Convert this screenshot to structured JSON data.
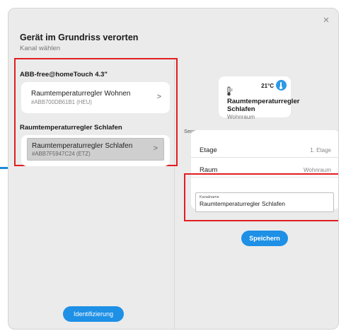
{
  "dialog": {
    "title": "Gerät im Grundriss verorten",
    "subtitle": "Kanal wählen",
    "close_symbol": "×"
  },
  "left_pane": {
    "groups": [
      {
        "header": "ABB-free@homeTouch 4.3\"",
        "devices": [
          {
            "name": "Raumtemperaturregler Wohnen",
            "id": "#ABB700DB61B1 (HEU)",
            "selected": false
          }
        ]
      },
      {
        "header": "Raumtemperaturregler Schlafen",
        "devices": [
          {
            "name": "Raumtemperaturregler Schlafen",
            "id": "#ABB7F5947C24 (ETZ)",
            "selected": true
          }
        ]
      }
    ],
    "chevron": ">",
    "identify_button": "Identifizierung"
  },
  "right_pane": {
    "tile": {
      "temperature": "21°C",
      "name": "Raumtemperaturregler Schlafen",
      "room": "Wohnraum",
      "icon": "thermometer-icon",
      "badge_icon": "heating-icon"
    },
    "section_label": "Sensor",
    "rows": [
      {
        "label": "Etage",
        "value": "1. Etage"
      },
      {
        "label": "Raum",
        "value": "Wohnraum"
      }
    ],
    "channel_name": {
      "label": "Kanalname",
      "value": "Raumtemperaturregler Schlafen"
    },
    "save_button": "Speichern"
  },
  "colors": {
    "accent": "#1e90e6",
    "highlight_border": "#e11d21",
    "dialog_bg": "#ebebeb"
  }
}
